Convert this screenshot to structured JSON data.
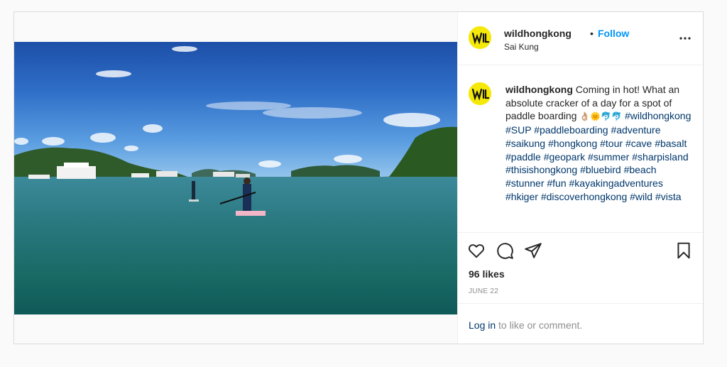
{
  "post": {
    "username": "wildhongkong",
    "dot": "•",
    "follow_label": "Follow",
    "location": "Sai Kung",
    "caption": {
      "username": "wildhongkong",
      "text": "Coming in hot! What an absolute cracker of a day for a spot of paddle boarding",
      "emojis": "👌🏼🌞🐬🐬",
      "hashtags": [
        "#wildhongkong",
        "#SUP",
        "#paddleboarding",
        "#adventure",
        "#saikung",
        "#hongkong",
        "#tour",
        "#cave",
        "#basalt",
        "#paddle",
        "#geopark",
        "#summer",
        "#sharpisland",
        "#thisishongkong",
        "#bluebird",
        "#beach",
        "#stunner",
        "#fun",
        "#kayakingadventures",
        "#hkiger",
        "#discoverhongkong",
        "#wild",
        "#vista"
      ]
    },
    "likes": "96 likes",
    "date": "JUNE 22",
    "login_link": "Log in",
    "login_rest": " to like or comment."
  },
  "icons": {
    "more": "more-options-icon",
    "like": "heart-icon",
    "comment": "comment-icon",
    "share": "share-icon",
    "save": "bookmark-icon"
  },
  "colors": {
    "accent": "#0095f6",
    "hashtag": "#00376b",
    "avatar": "#f5e90a",
    "muted": "#8e8e8e"
  }
}
